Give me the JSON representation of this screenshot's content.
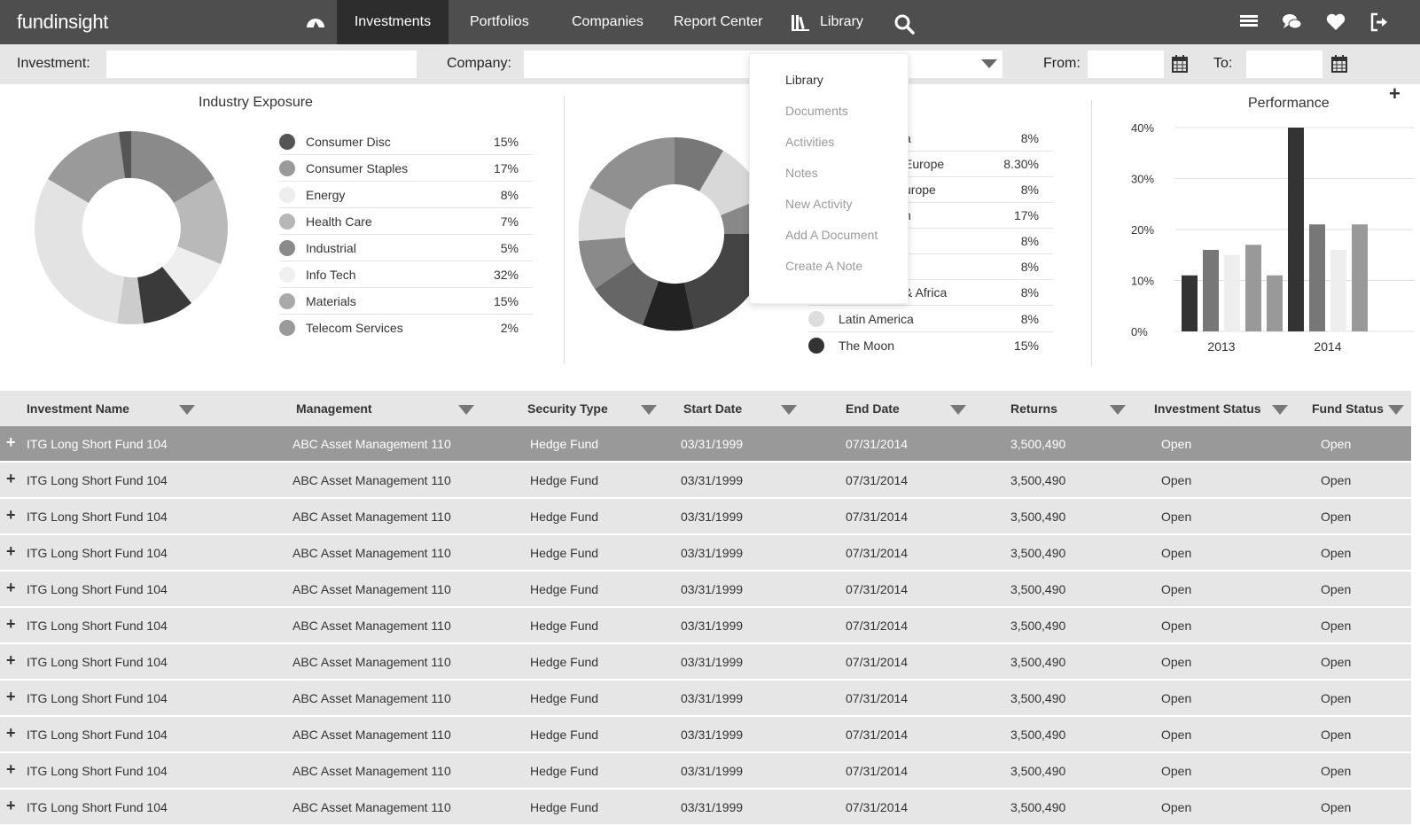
{
  "app": {
    "logo": "fundinsight"
  },
  "nav": {
    "items": [
      {
        "label": "Investments",
        "active": true
      },
      {
        "label": "Portfolios"
      },
      {
        "label": "Companies"
      },
      {
        "label": "Report Center"
      },
      {
        "label": "Library"
      }
    ],
    "icons": [
      "dashboard-icon",
      "books-icon",
      "search-icon",
      "list-icon",
      "chat-icon",
      "heart-icon",
      "logout-icon"
    ]
  },
  "filters": {
    "investment_label": "Investment:",
    "company_label": "Company:",
    "from_label": "From:",
    "to_label": "To:",
    "investment_value": "",
    "company_value": ""
  },
  "library_menu": {
    "items": [
      "Library",
      "Documents",
      "Activities",
      "Notes",
      "New Activity",
      "Add A Document",
      "Create A Note"
    ]
  },
  "industry": {
    "title": "Industry Exposure",
    "rows": [
      {
        "label": "Consumer Disc",
        "pct": "15%",
        "color": "#555555"
      },
      {
        "label": "Consumer Staples",
        "pct": "17%",
        "color": "#9a9a9a"
      },
      {
        "label": "Energy",
        "pct": "8%",
        "color": "#eeeeee"
      },
      {
        "label": "Health Care",
        "pct": "7%",
        "color": "#b7b7b7"
      },
      {
        "label": "Industrial",
        "pct": "5%",
        "color": "#8a8a8a"
      },
      {
        "label": "Info Tech",
        "pct": "32%",
        "color": "#f0f0f0"
      },
      {
        "label": "Materials",
        "pct": "15%",
        "color": "#a9a9a9"
      },
      {
        "label": "Telecom Services",
        "pct": "2%",
        "color": "#9a9a9a"
      }
    ]
  },
  "region": {
    "rows": [
      {
        "label": "a",
        "pct": "8%"
      },
      {
        "label": "Europe",
        "pct": "8.30%"
      },
      {
        "label": "urope",
        "pct": "8%"
      },
      {
        "label": "n",
        "pct": "17%"
      },
      {
        "label": "",
        "pct": "8%"
      },
      {
        "label": "",
        "pct": "8%"
      },
      {
        "label": "& Africa",
        "pct": "8%"
      },
      {
        "label": "Latin America",
        "pct": "8%",
        "color": "#dddddd"
      },
      {
        "label": "The Moon",
        "pct": "15%",
        "color": "#333333"
      }
    ]
  },
  "performance": {
    "title": "Performance",
    "plus_label": "+"
  },
  "chart_data": {
    "type": "bar",
    "title": "Performance",
    "categories": [
      "2013",
      "2014"
    ],
    "series": [
      {
        "values": [
          11,
          40
        ],
        "color": "#333333"
      },
      {
        "values": [
          16,
          21
        ],
        "color": "#777777"
      },
      {
        "values": [
          15,
          16
        ],
        "color": "#eeeeee"
      },
      {
        "values": [
          17,
          21
        ],
        "color": "#999999"
      },
      {
        "values": [
          11,
          null
        ],
        "color": "#999999"
      }
    ],
    "yticks": [
      "0%",
      "10%",
      "20%",
      "30%",
      "40%"
    ],
    "ylim": [
      0,
      40
    ]
  },
  "table": {
    "columns": [
      "Investment Name",
      "Management",
      "Security Type",
      "Start Date",
      "End Date",
      "Returns",
      "Investment Status",
      "Fund Status"
    ],
    "rows": [
      [
        "ITG Long Short Fund 104",
        "ABC Asset Management 110",
        "Hedge Fund",
        "03/31/1999",
        "07/31/2014",
        "3,500,490",
        "Open",
        "Open"
      ],
      [
        "ITG Long Short Fund 104",
        "ABC Asset Management 110",
        "Hedge Fund",
        "03/31/1999",
        "07/31/2014",
        "3,500,490",
        "Open",
        "Open"
      ],
      [
        "ITG Long Short Fund 104",
        "ABC Asset Management 110",
        "Hedge Fund",
        "03/31/1999",
        "07/31/2014",
        "3,500,490",
        "Open",
        "Open"
      ],
      [
        "ITG Long Short Fund 104",
        "ABC Asset Management 110",
        "Hedge Fund",
        "03/31/1999",
        "07/31/2014",
        "3,500,490",
        "Open",
        "Open"
      ],
      [
        "ITG Long Short Fund 104",
        "ABC Asset Management 110",
        "Hedge Fund",
        "03/31/1999",
        "07/31/2014",
        "3,500,490",
        "Open",
        "Open"
      ],
      [
        "ITG Long Short Fund 104",
        "ABC Asset Management 110",
        "Hedge Fund",
        "03/31/1999",
        "07/31/2014",
        "3,500,490",
        "Open",
        "Open"
      ],
      [
        "ITG Long Short Fund 104",
        "ABC Asset Management 110",
        "Hedge Fund",
        "03/31/1999",
        "07/31/2014",
        "3,500,490",
        "Open",
        "Open"
      ],
      [
        "ITG Long Short Fund 104",
        "ABC Asset Management 110",
        "Hedge Fund",
        "03/31/1999",
        "07/31/2014",
        "3,500,490",
        "Open",
        "Open"
      ],
      [
        "ITG Long Short Fund 104",
        "ABC Asset Management 110",
        "Hedge Fund",
        "03/31/1999",
        "07/31/2014",
        "3,500,490",
        "Open",
        "Open"
      ],
      [
        "ITG Long Short Fund 104",
        "ABC Asset Management 110",
        "Hedge Fund",
        "03/31/1999",
        "07/31/2014",
        "3,500,490",
        "Open",
        "Open"
      ],
      [
        "ITG Long Short Fund 104",
        "ABC Asset Management 110",
        "Hedge Fund",
        "03/31/1999",
        "07/31/2014",
        "3,500,490",
        "Open",
        "Open"
      ]
    ]
  }
}
